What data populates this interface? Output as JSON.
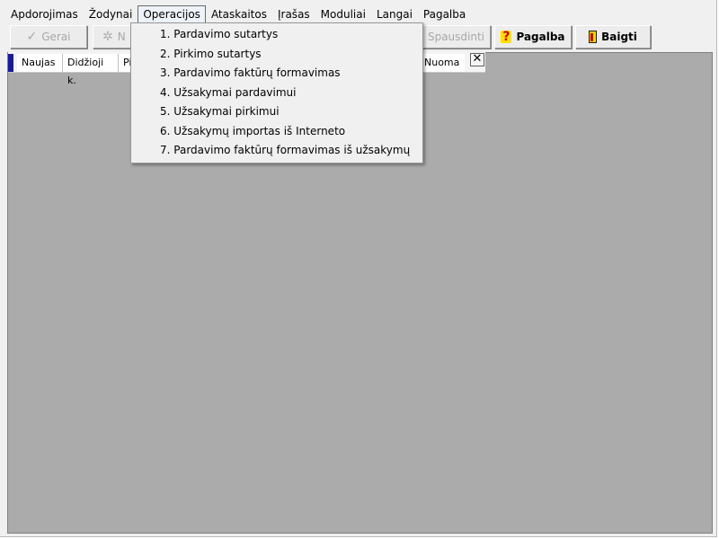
{
  "menubar": {
    "items": [
      "Apdorojimas",
      "Žodynai",
      "Operacijos",
      "Ataskaitos",
      "Įrašas",
      "Moduliai",
      "Langai",
      "Pagalba"
    ]
  },
  "toolbar": {
    "ok_label": "Gerai",
    "new_label": "N",
    "print_label": "Spausdinti",
    "help_label": "Pagalba",
    "exit_label": "Baigti"
  },
  "tabs": {
    "items": [
      "Naujas",
      "Didžioji k.",
      "Pi",
      "Nuoma"
    ],
    "close_label": "✕"
  },
  "dropdown": {
    "items": [
      "1. Pardavimo sutartys",
      "2. Pirkimo sutartys",
      "3. Pardavimo faktūrų formavimas",
      "4. Užsakymai pardavimui",
      "5. Užsakymai pirkimui",
      "6. Užsakymų importas iš Interneto",
      "7. Pardavimo faktūrų formavimas iš užsakymų"
    ]
  },
  "colors": {
    "mdi_background": "#ababab",
    "tab_accent": "#1a1aa0",
    "help_icon": "#ffe000",
    "exit_icon": "#f7d200"
  }
}
